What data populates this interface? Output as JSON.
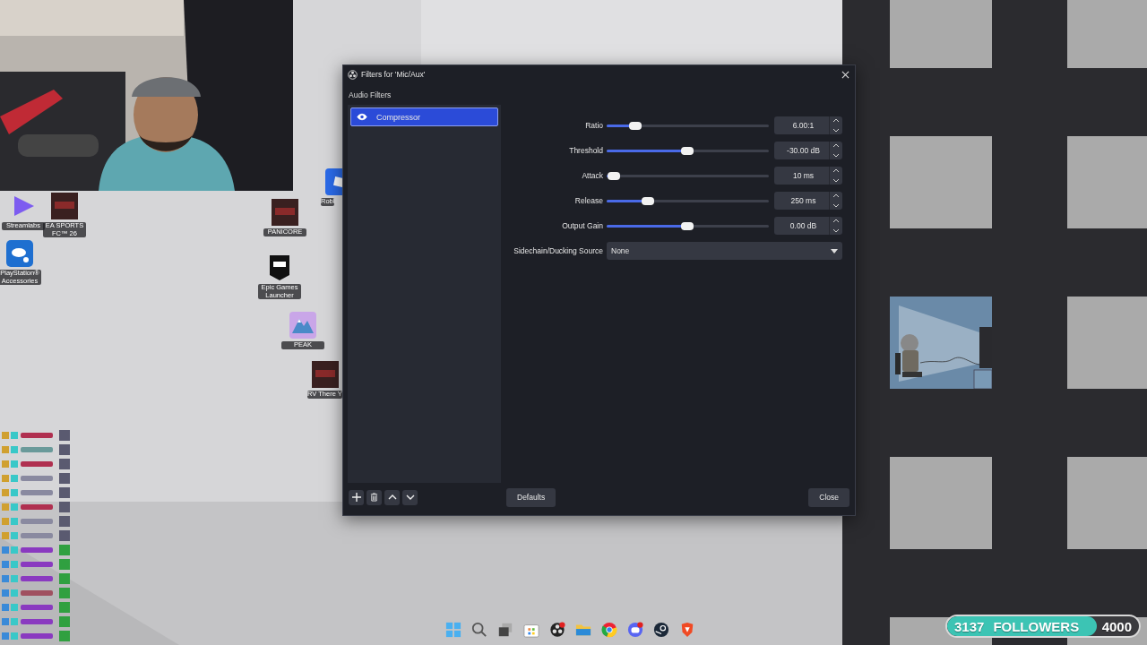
{
  "desktop_icons": [
    {
      "label": "Streamlabs",
      "kind": "streamlabs"
    },
    {
      "label": "EA SPORTS FC™ 26",
      "kind": "game"
    },
    {
      "label": "PlayStation® Accessories",
      "kind": "playstation"
    },
    {
      "label": "PANICORE",
      "kind": "game"
    },
    {
      "label": "Epic Games Launcher",
      "kind": "epic"
    },
    {
      "label": "PEAK",
      "kind": "peak"
    },
    {
      "label": "RV There Y",
      "kind": "game"
    },
    {
      "label": "Robl",
      "kind": "roblox"
    }
  ],
  "dialog": {
    "title": "Filters for 'Mic/Aux'",
    "section": "Audio Filters",
    "filters": [
      {
        "name": "Compressor",
        "visible": true,
        "selected": true
      }
    ],
    "properties": [
      {
        "label": "Ratio",
        "kind": "slider",
        "level": 0.18,
        "value": "6.00:1"
      },
      {
        "label": "Threshold",
        "kind": "slider",
        "level": 0.5,
        "value": "-30.00 dB"
      },
      {
        "label": "Attack",
        "kind": "slider",
        "level": 0.05,
        "value": "10 ms"
      },
      {
        "label": "Release",
        "kind": "slider",
        "level": 0.26,
        "value": "250 ms"
      },
      {
        "label": "Output Gain",
        "kind": "slider",
        "level": 0.5,
        "value": "0.00 dB"
      },
      {
        "label": "Sidechain/Ducking Source",
        "kind": "dropdown",
        "value": "None"
      }
    ],
    "defaults_button": "Defaults",
    "close_button": "Close"
  },
  "taskbar": [
    {
      "kind": "start",
      "badge": false
    },
    {
      "kind": "search",
      "badge": false
    },
    {
      "kind": "taskview",
      "badge": false
    },
    {
      "kind": "store",
      "badge": false
    },
    {
      "kind": "obs",
      "badge": true
    },
    {
      "kind": "folder",
      "badge": false
    },
    {
      "kind": "chrome",
      "badge": false
    },
    {
      "kind": "discord",
      "badge": true
    },
    {
      "kind": "steam",
      "badge": false
    },
    {
      "kind": "brave",
      "badge": false
    }
  ],
  "followers": {
    "current": "3137",
    "label": "FOLLOWERS",
    "goal": "4000",
    "level": 0.78
  }
}
